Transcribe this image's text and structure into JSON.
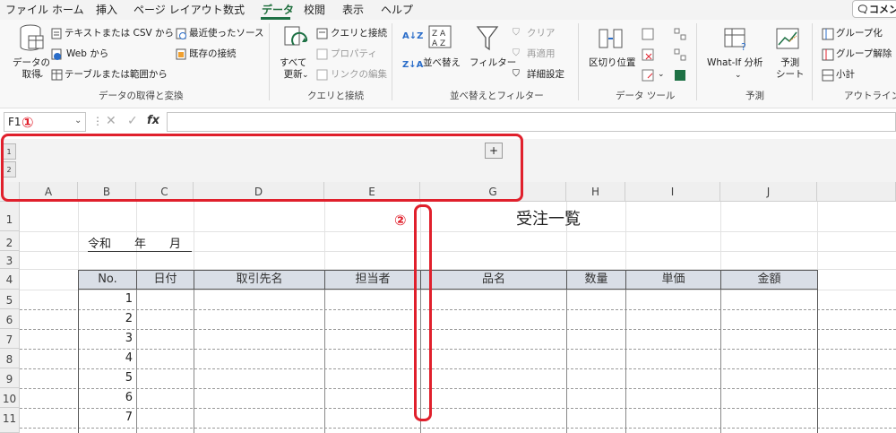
{
  "menu": {
    "items": [
      "ファイル",
      "ホーム",
      "挿入",
      "ページ レイアウト",
      "数式",
      "データ",
      "校閲",
      "表示",
      "ヘルプ"
    ],
    "active": "データ",
    "comment_label": "コメント"
  },
  "ribbon": {
    "get_data": {
      "big_button": "データの\n取得",
      "text_csv": "テキストまたは CSV から",
      "web": "Web から",
      "table_range": "テーブルまたは範囲から",
      "recent_sources": "最近使ったソース",
      "existing_conn": "既存の接続",
      "label": "データの取得と変換"
    },
    "queries": {
      "refresh_all": "すべて\n更新",
      "queries_conn": "クエリと接続",
      "properties": "プロパティ",
      "edit_links": "リンクの編集",
      "label": "クエリと接続"
    },
    "sort_filter": {
      "sort": "並べ替え",
      "filter": "フィルター",
      "clear": "クリア",
      "reapply": "再適用",
      "advanced": "詳細設定",
      "label": "並べ替えとフィルター"
    },
    "data_tools": {
      "text_to_columns": "区切り位置",
      "label": "データ ツール"
    },
    "forecast": {
      "whatif": "What-If 分析",
      "forecast_sheet": "予測\nシート",
      "label": "予測"
    },
    "outline": {
      "group": "グループ化",
      "ungroup": "グループ解除",
      "subtotal": "小計",
      "label": "アウトライン"
    }
  },
  "formula_bar": {
    "name_box": "F1",
    "fx": "fx",
    "content": ""
  },
  "outline_levels": [
    "1",
    "2"
  ],
  "outline_plus": "+",
  "annotations": {
    "one": "①",
    "two": "②"
  },
  "columns": [
    "A",
    "B",
    "C",
    "D",
    "E",
    "G",
    "H",
    "I",
    "J"
  ],
  "rows": [
    "1",
    "2",
    "3",
    "4",
    "5",
    "6",
    "7",
    "8",
    "9",
    "10",
    "11"
  ],
  "sheet": {
    "title": "受注一覧",
    "date_line": "令和　　年　　月",
    "headers": [
      "No.",
      "日付",
      "取引先名",
      "担当者",
      "品名",
      "数量",
      "単価",
      "金額"
    ],
    "numbers": [
      "1",
      "2",
      "3",
      "4",
      "5",
      "6",
      "7"
    ]
  },
  "colors": {
    "accent": "#1e7145",
    "annotation": "#e0202c",
    "table_header_bg": "#d9dee6"
  }
}
